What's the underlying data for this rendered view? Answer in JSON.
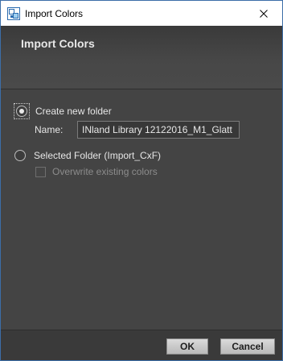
{
  "window": {
    "title": "Import Colors",
    "app_icon": "color-import-icon",
    "close_icon": "close-icon"
  },
  "header": {
    "title": "Import Colors"
  },
  "options": {
    "create_new_folder": {
      "label": "Create new folder",
      "selected": true
    },
    "name_label": "Name:",
    "name_value": "INland Library 12122016_M1_Glatt",
    "selected_folder": {
      "label": "Selected Folder (Import_CxF)",
      "selected": false
    },
    "overwrite_existing": {
      "label": "Overwrite existing colors",
      "checked": false,
      "enabled": false
    }
  },
  "footer": {
    "ok_label": "OK",
    "cancel_label": "Cancel"
  },
  "colors": {
    "background": "#444444",
    "header": "#474747",
    "text": "#e6e6e6",
    "disabled_text": "#8c8c8c"
  }
}
